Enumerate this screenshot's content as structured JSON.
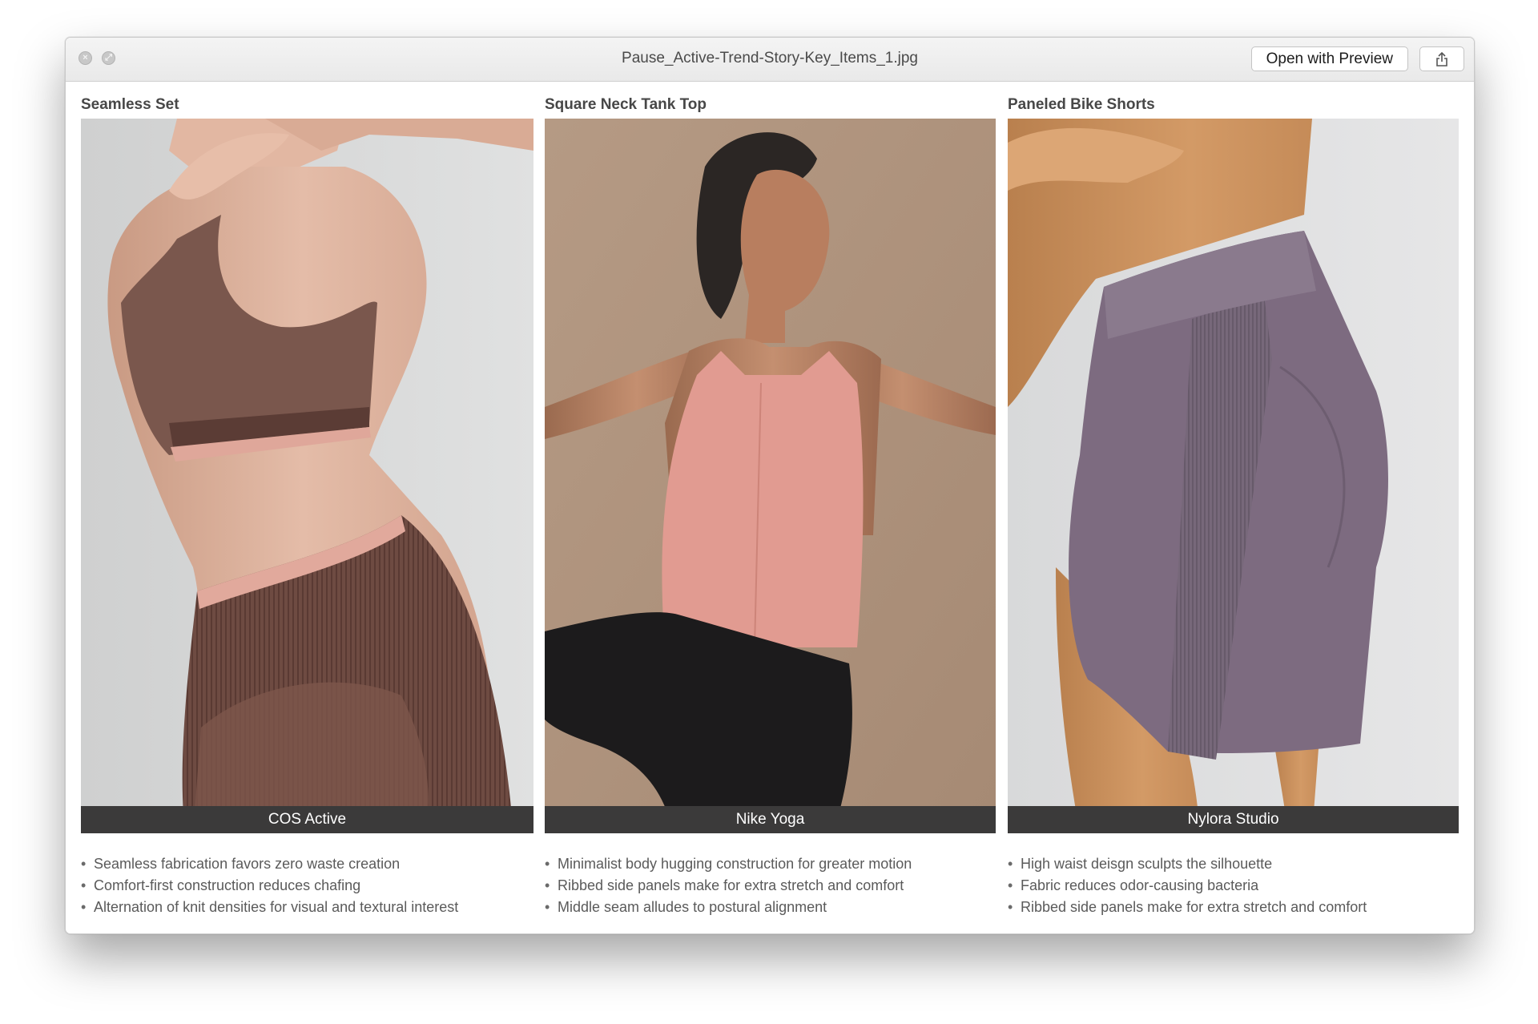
{
  "window": {
    "title": "Pause_Active-Trend-Story-Key_Items_1.jpg",
    "open_button": "Open with Preview",
    "share_icon": "share-icon",
    "close_icon": "close-icon",
    "minimize_icon": "fullscreen-icon"
  },
  "columns": [
    {
      "title": "Seamless Set",
      "brand": "COS Active",
      "bullets": [
        "Seamless fabrication favors zero waste creation",
        "Comfort-first construction reduces chafing",
        "Alternation of knit densities for visual and textural interest"
      ]
    },
    {
      "title": "Square Neck Tank Top",
      "brand": "Nike Yoga",
      "bullets": [
        "Minimalist body hugging construction for greater motion",
        "Ribbed side panels make for extra stretch and comfort",
        "Middle seam alludes to postural alignment"
      ]
    },
    {
      "title": "Paneled Bike Shorts",
      "brand": "Nylora Studio",
      "bullets": [
        "High waist deisgn sculpts the silhouette",
        "Fabric reduces odor-causing bacteria",
        "Ribbed side panels make for extra stretch and comfort"
      ]
    }
  ]
}
